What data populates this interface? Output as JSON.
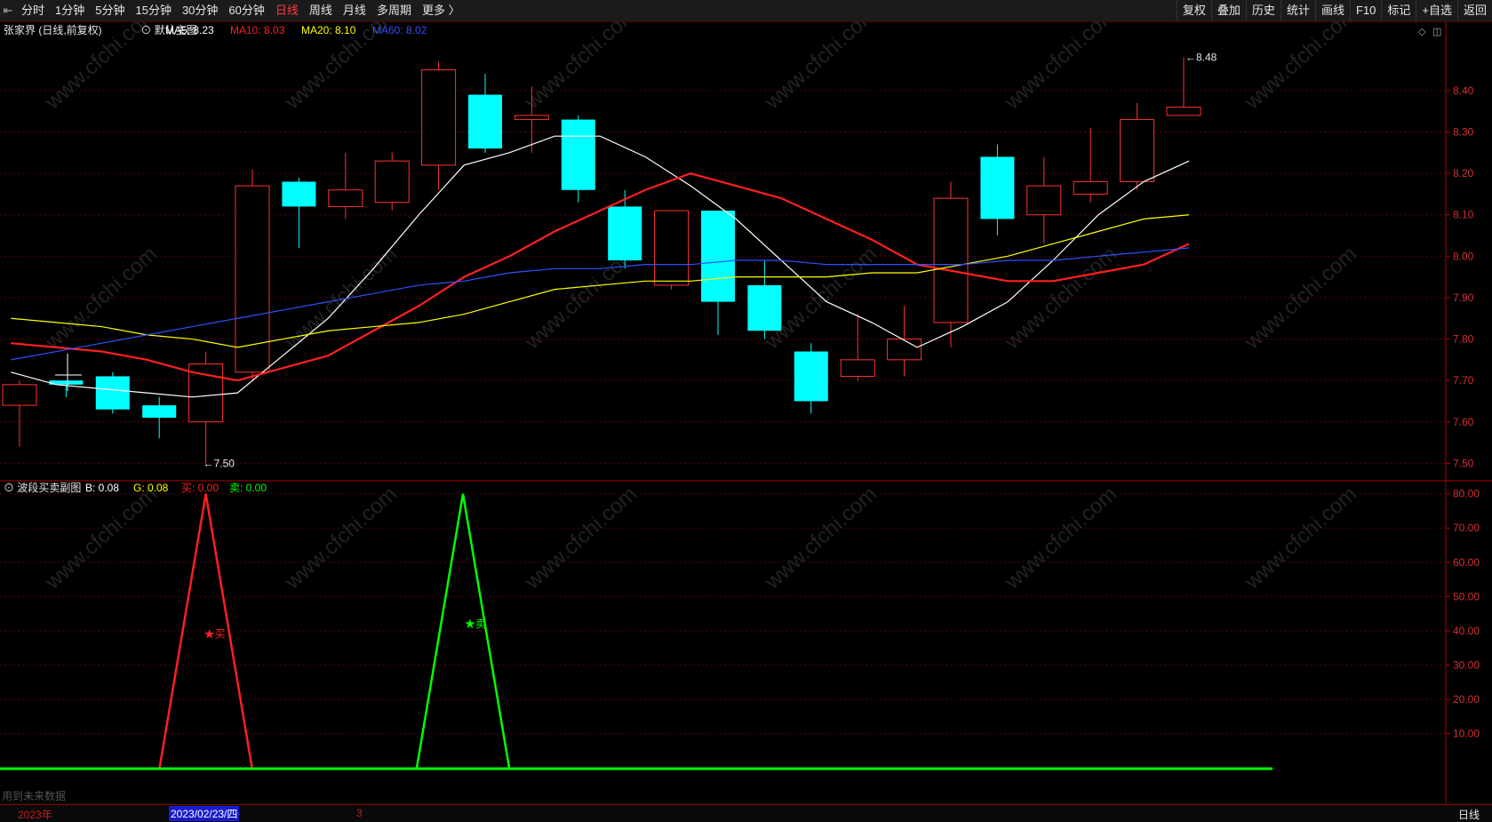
{
  "toolbar": {
    "periods": [
      "分时",
      "1分钟",
      "5分钟",
      "15分钟",
      "30分钟",
      "60分钟",
      "日线",
      "周线",
      "月线",
      "多周期",
      "更多 〉"
    ],
    "active": "日线",
    "actions": [
      "复权",
      "叠加",
      "历史",
      "统计",
      "画线",
      "F10",
      "标记",
      "+自选",
      "返回"
    ]
  },
  "main_header": {
    "name": "张家界 (日线,前复权)",
    "template": "默认主图",
    "ma": [
      {
        "label": "MA5: 8.23",
        "color": "#ffffff"
      },
      {
        "label": "MA10: 8.03",
        "color": "#ff2020"
      },
      {
        "label": "MA20: 8.10",
        "color": "#ffff00"
      },
      {
        "label": "MA60: 8.02",
        "color": "#3050ff"
      }
    ]
  },
  "sub_header": {
    "name": "波段买卖副图",
    "items": [
      {
        "label": "B: 0.08",
        "color": "#ffffff"
      },
      {
        "label": "G: 0.08",
        "color": "#ffff00"
      },
      {
        "label": "买: 0.00",
        "color": "#ff2020"
      },
      {
        "label": "卖: 0.00",
        "color": "#00ff00"
      }
    ]
  },
  "chart_data": [
    {
      "type": "candlestick",
      "ylim": [
        7.46,
        8.52
      ],
      "y_ticks": [
        "8.40",
        "8.30",
        "8.20",
        "8.10",
        "8.00",
        "7.90",
        "7.80",
        "7.70",
        "7.60",
        "7.50"
      ],
      "candles": [
        {
          "o": 7.64,
          "h": 7.7,
          "l": 7.54,
          "c": 7.69
        },
        {
          "o": 7.7,
          "h": 7.7,
          "l": 7.66,
          "c": 7.69
        },
        {
          "o": 7.71,
          "h": 7.72,
          "l": 7.62,
          "c": 7.63
        },
        {
          "o": 7.64,
          "h": 7.66,
          "l": 7.56,
          "c": 7.61
        },
        {
          "o": 7.6,
          "h": 7.77,
          "l": 7.5,
          "c": 7.74
        },
        {
          "o": 7.72,
          "h": 8.21,
          "l": 7.7,
          "c": 8.17
        },
        {
          "o": 8.18,
          "h": 8.19,
          "l": 8.02,
          "c": 8.12
        },
        {
          "o": 8.12,
          "h": 8.25,
          "l": 8.09,
          "c": 8.16
        },
        {
          "o": 8.13,
          "h": 8.25,
          "l": 8.11,
          "c": 8.23
        },
        {
          "o": 8.22,
          "h": 8.47,
          "l": 8.16,
          "c": 8.45
        },
        {
          "o": 8.39,
          "h": 8.44,
          "l": 8.25,
          "c": 8.26
        },
        {
          "o": 8.33,
          "h": 8.41,
          "l": 8.25,
          "c": 8.34
        },
        {
          "o": 8.33,
          "h": 8.34,
          "l": 8.13,
          "c": 8.16
        },
        {
          "o": 8.12,
          "h": 8.16,
          "l": 7.97,
          "c": 7.99
        },
        {
          "o": 7.93,
          "h": 8.11,
          "l": 7.92,
          "c": 8.11
        },
        {
          "o": 8.11,
          "h": 8.11,
          "l": 7.81,
          "c": 7.89
        },
        {
          "o": 7.93,
          "h": 7.99,
          "l": 7.8,
          "c": 7.82
        },
        {
          "o": 7.77,
          "h": 7.79,
          "l": 7.62,
          "c": 7.65
        },
        {
          "o": 7.71,
          "h": 7.86,
          "l": 7.7,
          "c": 7.75
        },
        {
          "o": 7.75,
          "h": 7.88,
          "l": 7.71,
          "c": 7.8
        },
        {
          "o": 7.84,
          "h": 8.18,
          "l": 7.78,
          "c": 8.14
        },
        {
          "o": 8.24,
          "h": 8.27,
          "l": 8.05,
          "c": 8.09
        },
        {
          "o": 8.1,
          "h": 8.24,
          "l": 8.03,
          "c": 8.17
        },
        {
          "o": 8.15,
          "h": 8.31,
          "l": 8.13,
          "c": 8.18
        },
        {
          "o": 8.18,
          "h": 8.37,
          "l": 8.16,
          "c": 8.33
        },
        {
          "o": 8.34,
          "h": 8.48,
          "l": 8.34,
          "c": 8.36
        }
      ],
      "series": [
        {
          "name": "MA5",
          "color": "#ffffff",
          "values": [
            7.72,
            7.69,
            7.68,
            7.67,
            7.66,
            7.67,
            7.76,
            7.85,
            7.97,
            8.1,
            8.22,
            8.25,
            8.29,
            8.29,
            8.24,
            8.17,
            8.09,
            7.99,
            7.89,
            7.84,
            7.78,
            7.83,
            7.89,
            7.99,
            8.1,
            8.18,
            8.23
          ]
        },
        {
          "name": "MA10",
          "color": "#ff2020",
          "values": [
            7.79,
            7.78,
            7.77,
            7.75,
            7.72,
            7.7,
            7.73,
            7.76,
            7.82,
            7.88,
            7.95,
            8.0,
            8.06,
            8.11,
            8.16,
            8.2,
            8.17,
            8.14,
            8.09,
            8.04,
            7.98,
            7.96,
            7.94,
            7.94,
            7.96,
            7.98,
            8.03
          ]
        },
        {
          "name": "MA20",
          "color": "#ffff00",
          "values": [
            7.85,
            7.84,
            7.83,
            7.81,
            7.8,
            7.78,
            7.8,
            7.82,
            7.83,
            7.84,
            7.86,
            7.89,
            7.92,
            7.93,
            7.94,
            7.94,
            7.95,
            7.95,
            7.95,
            7.96,
            7.96,
            7.98,
            8.0,
            8.03,
            8.06,
            8.09,
            8.1
          ]
        },
        {
          "name": "MA60",
          "color": "#3050ff",
          "values": [
            7.75,
            7.77,
            7.79,
            7.81,
            7.83,
            7.85,
            7.87,
            7.89,
            7.91,
            7.93,
            7.94,
            7.96,
            7.97,
            7.97,
            7.98,
            7.98,
            7.99,
            7.99,
            7.98,
            7.98,
            7.98,
            7.98,
            7.99,
            7.99,
            8.0,
            8.01,
            8.02
          ]
        }
      ],
      "annotations": [
        {
          "text": "←7.50"
        },
        {
          "text": "←8.48"
        }
      ]
    },
    {
      "type": "line",
      "title": "波段买卖副图",
      "ylim": [
        0,
        82
      ],
      "y_ticks": [
        "80.00",
        "70.00",
        "60.00",
        "50.00",
        "40.00",
        "30.00",
        "20.00",
        "10.00"
      ],
      "series": [
        {
          "name": "买",
          "color": "#ff2020",
          "values": [
            0,
            0,
            0,
            0,
            80,
            0,
            0,
            0,
            0,
            0,
            0,
            0,
            0,
            0,
            0,
            0,
            0,
            0,
            0,
            0,
            0,
            0,
            0,
            0,
            0,
            0
          ]
        },
        {
          "name": "卖",
          "color": "#00ff00",
          "values": [
            0,
            0,
            0,
            0,
            0,
            0,
            0,
            0,
            0,
            0,
            80,
            0,
            0,
            0,
            0,
            0,
            0,
            0,
            0,
            0,
            0,
            0,
            0,
            0,
            0,
            0
          ]
        }
      ],
      "annotations": [
        {
          "text": "★买"
        },
        {
          "text": "★卖"
        }
      ]
    }
  ],
  "footer": {
    "year": "2023年",
    "date": "2023/02/23/四",
    "mark": "3",
    "period": "日线",
    "bottom_text": "用到未来数据"
  },
  "watermark": "www.cfchi.com"
}
